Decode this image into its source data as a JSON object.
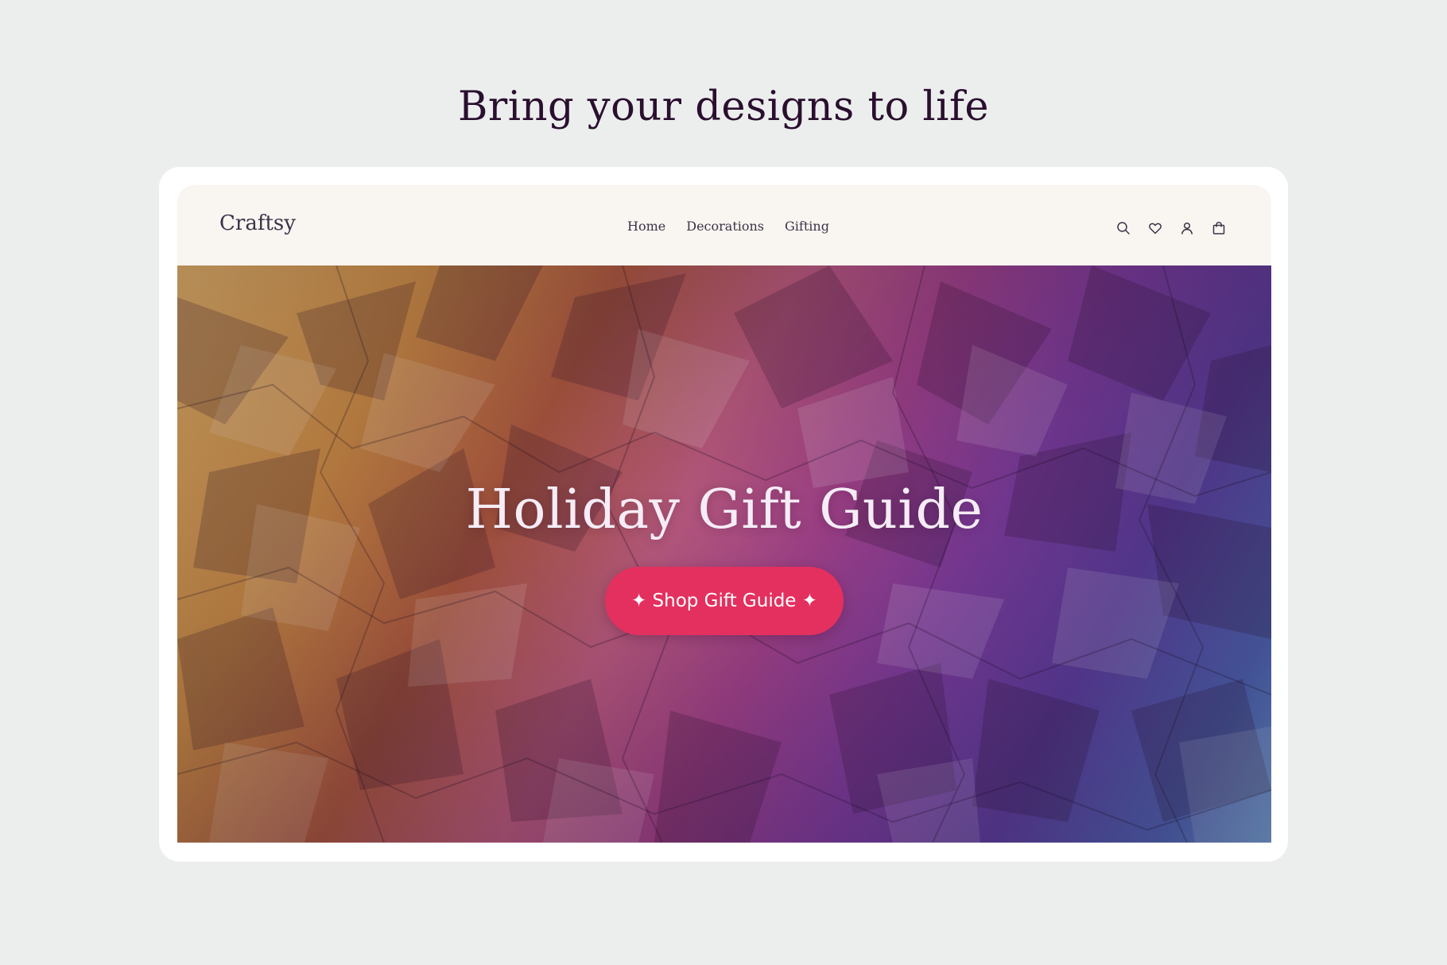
{
  "headline": "Bring your designs to life",
  "site": {
    "brand": "Craftsy",
    "nav": [
      {
        "label": "Home"
      },
      {
        "label": "Decorations"
      },
      {
        "label": "Gifting"
      }
    ],
    "icons": [
      "search-icon",
      "heart-icon",
      "account-icon",
      "shopping-bag-icon"
    ]
  },
  "hero": {
    "title": "Holiday Gift Guide",
    "cta_label": "✦ Shop Gift Guide ✦",
    "background": "crumpled paper gradient: gold to magenta to purple to blue"
  },
  "colors": {
    "page_bg": "#eceeed",
    "headline": "#2a0f2f",
    "nav_bg": "#f9f5f0",
    "nav_text": "#3a3348",
    "cta": "#e4305f",
    "hero_text": "#f5ecf6"
  }
}
